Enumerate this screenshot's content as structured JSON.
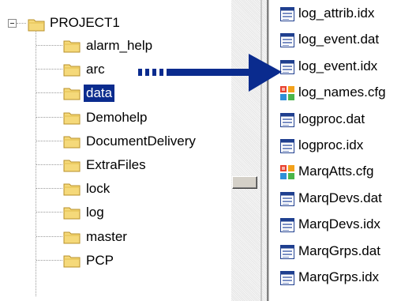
{
  "tree": {
    "root": {
      "label": "PROJECT1",
      "expanded": true
    },
    "folders": [
      {
        "label": "alarm_help",
        "selected": false
      },
      {
        "label": "arc",
        "selected": false
      },
      {
        "label": "data",
        "selected": true
      },
      {
        "label": "Demohelp",
        "selected": false
      },
      {
        "label": "DocumentDelivery",
        "selected": false
      },
      {
        "label": "ExtraFiles",
        "selected": false
      },
      {
        "label": "lock",
        "selected": false
      },
      {
        "label": "log",
        "selected": false
      },
      {
        "label": "master",
        "selected": false
      },
      {
        "label": "PCP",
        "selected": false
      }
    ]
  },
  "files": [
    {
      "label": "log_attrib.idx",
      "icon": "data-file-icon"
    },
    {
      "label": "log_event.dat",
      "icon": "data-file-icon"
    },
    {
      "label": "log_event.idx",
      "icon": "data-file-icon"
    },
    {
      "label": "log_names.cfg",
      "icon": "config-file-icon"
    },
    {
      "label": "logproc.dat",
      "icon": "data-file-icon"
    },
    {
      "label": "logproc.idx",
      "icon": "data-file-icon"
    },
    {
      "label": "MarqAtts.cfg",
      "icon": "config-file-icon"
    },
    {
      "label": "MarqDevs.dat",
      "icon": "data-file-icon"
    },
    {
      "label": "MarqDevs.idx",
      "icon": "data-file-icon"
    },
    {
      "label": "MarqGrps.dat",
      "icon": "data-file-icon"
    },
    {
      "label": "MarqGrps.idx",
      "icon": "data-file-icon"
    }
  ],
  "colors": {
    "selection": "#0a2b8e",
    "arrow": "#0a2b8e",
    "folder_fill": "#f5d97a",
    "folder_stroke": "#b8902a"
  }
}
